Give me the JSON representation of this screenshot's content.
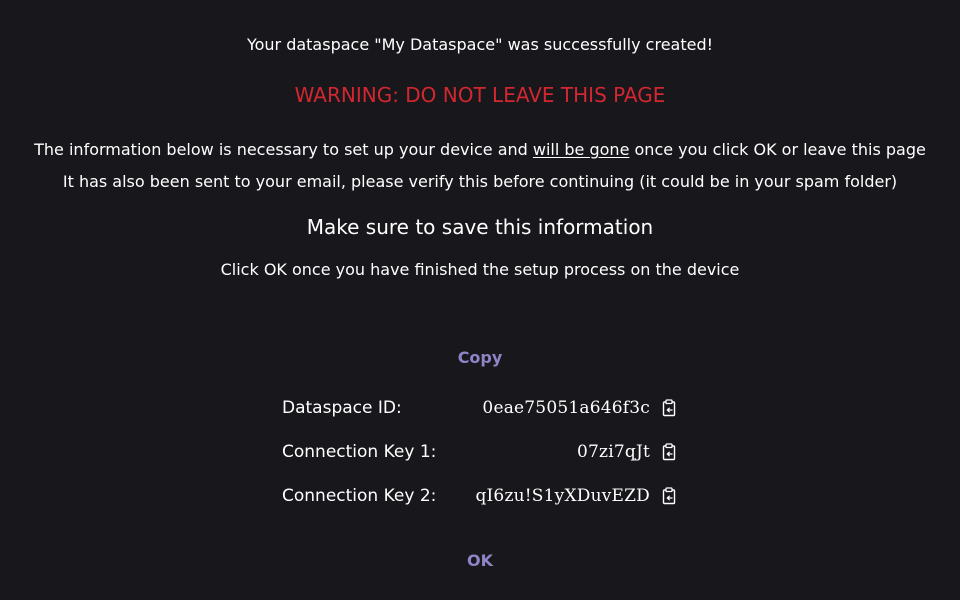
{
  "messages": {
    "success": "Your dataspace \"My Dataspace\" was successfully created!",
    "warning": "WARNING: DO NOT LEAVE THIS PAGE",
    "info_line1_before": "The information below is necessary to set up your device and ",
    "info_line1_underlined": "will be gone",
    "info_line1_after": " once you click OK or leave this page",
    "info_line2": "It has also been sent to your email, please verify this before continuing (it could be in your spam folder)",
    "save_heading": "Make sure to save this information",
    "click_ok_hint": "Click OK once you have finished the setup process on the device"
  },
  "actions": {
    "copy_label": "Copy",
    "ok_label": "OK"
  },
  "credentials": [
    {
      "label": "Dataspace ID:",
      "value": "0eae75051a646f3c",
      "icon": "clipboard-icon"
    },
    {
      "label": "Connection Key 1:",
      "value": "07zi7qJt",
      "icon": "clipboard-icon"
    },
    {
      "label": "Connection Key 2:",
      "value": "qI6zu!S1yXDuvEZD",
      "icon": "clipboard-icon"
    }
  ],
  "colors": {
    "background": "#18171c",
    "text": "#ffffff",
    "warning": "#d32730",
    "accent": "#8f84c7"
  }
}
